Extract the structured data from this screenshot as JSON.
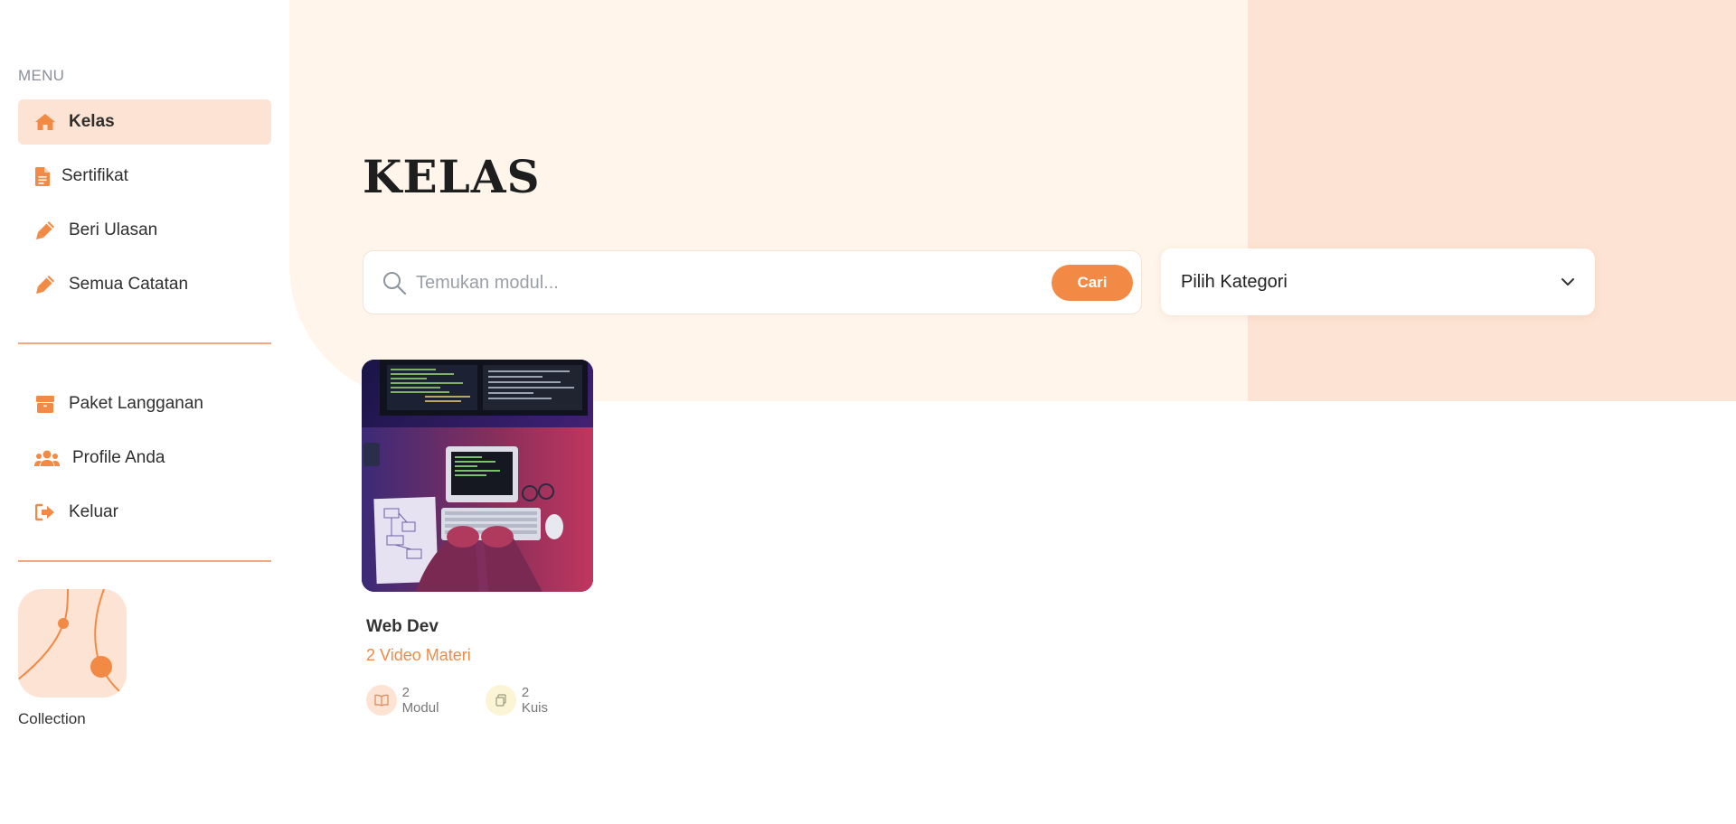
{
  "sidebar": {
    "menu_label": "MENU",
    "items_primary": [
      {
        "label": "Kelas",
        "icon": "home-icon",
        "active": true
      },
      {
        "label": "Sertifikat",
        "icon": "document-icon",
        "active": false
      },
      {
        "label": "Beri Ulasan",
        "icon": "pencil-icon",
        "active": false
      },
      {
        "label": "Semua Catatan",
        "icon": "pencil-icon",
        "active": false
      }
    ],
    "items_secondary": [
      {
        "label": "Paket Langganan",
        "icon": "box-icon"
      },
      {
        "label": "Profile Anda",
        "icon": "users-icon"
      },
      {
        "label": "Keluar",
        "icon": "sign-out-icon"
      }
    ],
    "collection_label": "Collection"
  },
  "main": {
    "title": "KELAS",
    "search": {
      "placeholder": "Temukan modul...",
      "value": "",
      "button_label": "Cari"
    },
    "category_select": {
      "selected": "Pilih Kategori"
    },
    "courses": [
      {
        "title": "Web Dev",
        "videos": "2 Video Materi",
        "modules": "2 Modul",
        "quizzes": "2 Kuis"
      }
    ]
  },
  "colors": {
    "accent": "#f28a45",
    "active_bg": "#fde3d3",
    "cream_bg": "#fff5ea",
    "peach_bg": "#fde3d3",
    "divider": "#f4a87a"
  }
}
